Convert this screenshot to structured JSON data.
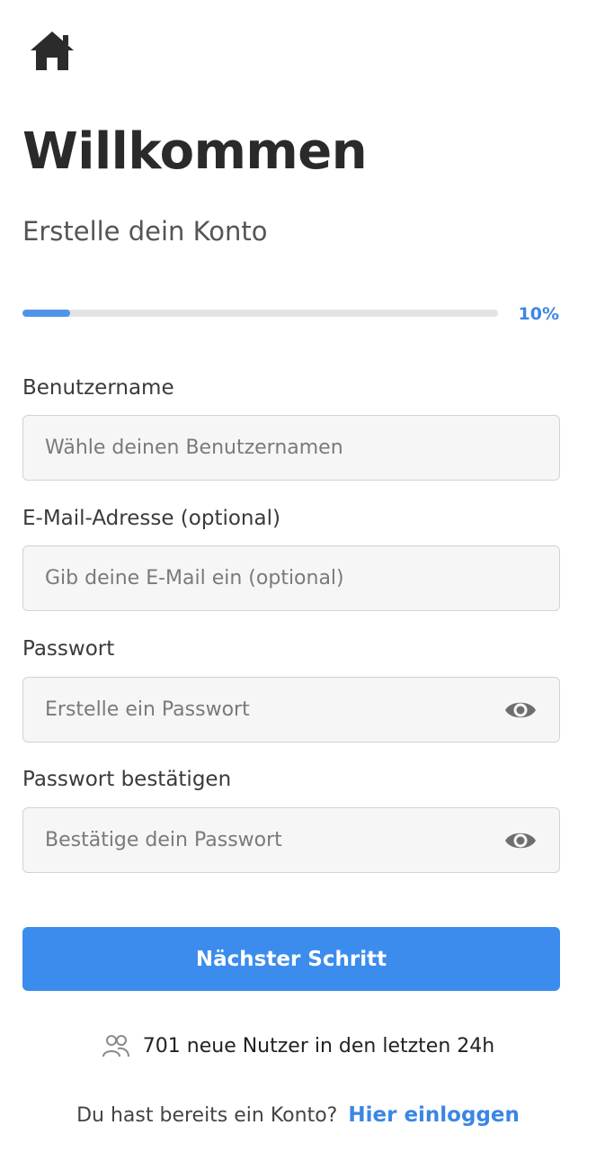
{
  "header": {
    "home_icon": "home-icon",
    "title": "Willkommen",
    "subtitle": "Erstelle dein Konto"
  },
  "progress": {
    "percent": 10,
    "label": "10%",
    "color": "#4f93ea"
  },
  "form": {
    "username": {
      "label": "Benutzername",
      "placeholder": "Wähle deinen Benutzernamen",
      "value": ""
    },
    "email": {
      "label": "E-Mail-Adresse (optional)",
      "placeholder": "Gib deine E-Mail ein (optional)",
      "value": ""
    },
    "password": {
      "label": "Passwort",
      "placeholder": "Erstelle ein Passwort",
      "value": "",
      "toggle_icon": "eye-icon"
    },
    "confirm_password": {
      "label": "Passwort bestätigen",
      "placeholder": "Bestätige dein Passwort",
      "value": "",
      "toggle_icon": "eye-icon"
    }
  },
  "actions": {
    "next_label": "Nächster Schritt",
    "primary_color": "#3b8ced"
  },
  "stats": {
    "icon": "users-icon",
    "text": "701 neue Nutzer in den letzten 24h"
  },
  "footer": {
    "question": "Du hast bereits ein Konto?",
    "link_label": "Hier einloggen"
  }
}
